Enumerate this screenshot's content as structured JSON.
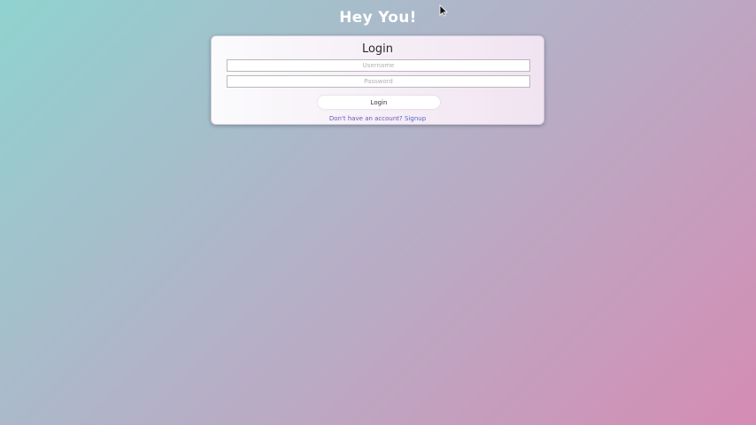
{
  "header": {
    "title": "Hey You!"
  },
  "login_form": {
    "title": "Login",
    "username_placeholder": "Username",
    "password_placeholder": "Password",
    "submit_label": "Login",
    "signup_prompt": "Don't have an account?",
    "signup_link_label": "Signup"
  },
  "theme": {
    "gradient_start": "#8fd3cf",
    "gradient_end": "#d58cb4",
    "link_color": "#5a66c8"
  },
  "cursor": {
    "icon": "mouse-pointer-icon"
  }
}
